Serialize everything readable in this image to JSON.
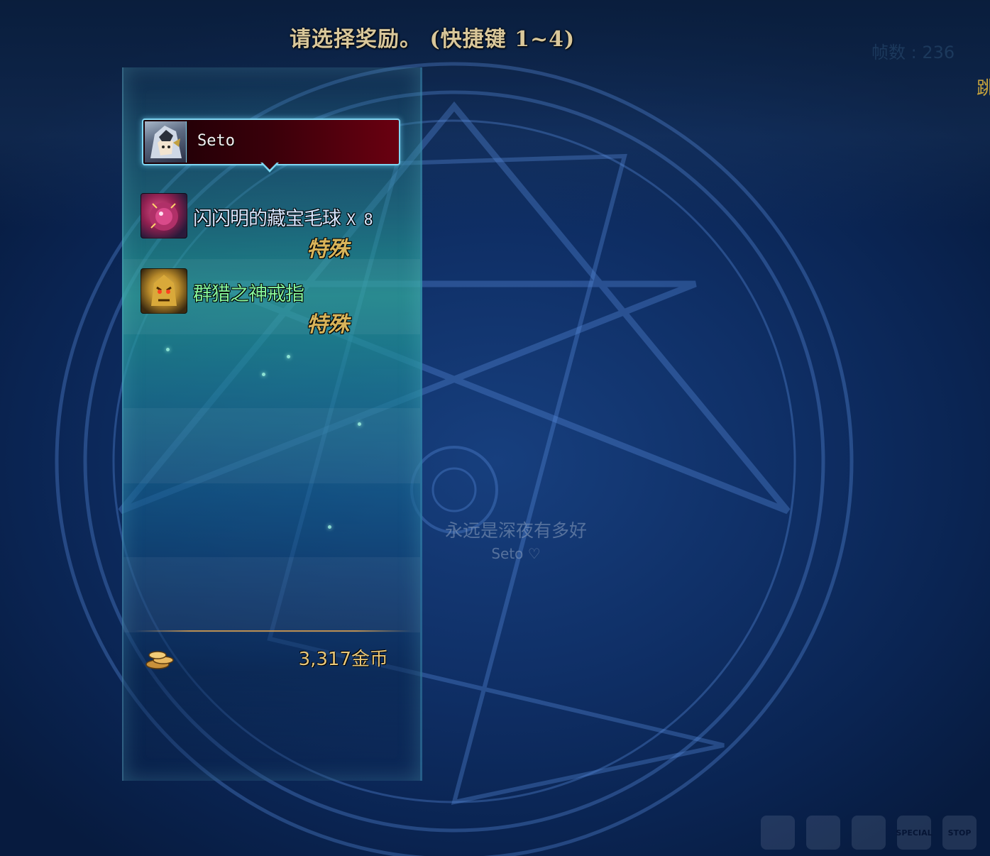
{
  "header": {
    "prompt": "请选择奖励。 (快捷键 1~4)",
    "fps_label": "帧数 : 236",
    "side_text": "跳"
  },
  "reward_panel": {
    "player_name": "Seto",
    "items": [
      {
        "name": "闪闪明的藏宝毛球",
        "quantity": "X 8",
        "rarity": "特殊",
        "name_color": "#d6e6ff",
        "icon": "treasure-furball-icon"
      },
      {
        "name": "群猎之神戒指",
        "quantity": "",
        "rarity": "特殊",
        "name_color": "#86f59b",
        "icon": "hunt-god-ring-icon"
      }
    ],
    "gold": "3,317金币",
    "gold_icon": "gold-coins-icon"
  },
  "nametag": {
    "title": "永远是深夜有多好",
    "name": "Seto ♡"
  },
  "hotbar": {
    "items": [
      "",
      "",
      "",
      "SPECIAL",
      "STOP",
      ""
    ]
  },
  "colors": {
    "title": "#d9c79a",
    "rarity": "#d8b45a",
    "panel_border": "#7fd6f2",
    "gold_text": "#e8c77a"
  }
}
